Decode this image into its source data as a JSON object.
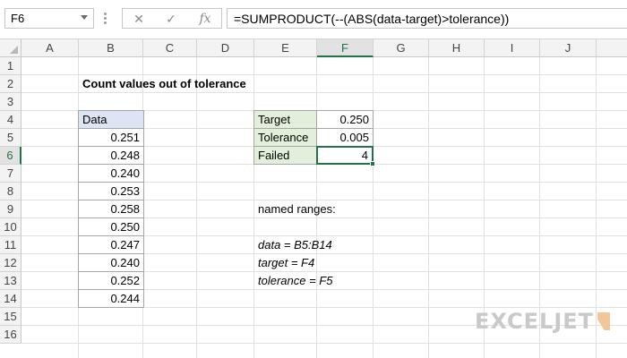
{
  "formula_bar": {
    "name_box": "F6",
    "cancel_symbol": "✕",
    "enter_symbol": "✓",
    "fx_symbol": "fx",
    "formula": "=SUMPRODUCT(--(ABS(data-target)>tolerance))"
  },
  "columns": [
    "A",
    "B",
    "C",
    "D",
    "E",
    "F",
    "G",
    "H",
    "I",
    "J"
  ],
  "active_column": "F",
  "rows": [
    "1",
    "2",
    "3",
    "4",
    "5",
    "6",
    "7",
    "8",
    "9",
    "10",
    "11",
    "12",
    "13",
    "14",
    "15",
    "16"
  ],
  "active_row": "6",
  "sheet": {
    "title": "Count values out of tolerance",
    "data_header": "Data",
    "data_values": [
      "0.251",
      "0.248",
      "0.240",
      "0.253",
      "0.258",
      "0.250",
      "0.247",
      "0.240",
      "0.252",
      "0.244"
    ],
    "inputs": [
      {
        "label": "Target",
        "value": "0.250"
      },
      {
        "label": "Tolerance",
        "value": "0.005"
      },
      {
        "label": "Failed",
        "value": "4"
      }
    ],
    "named_ranges_title": "named ranges:",
    "named_ranges": [
      "data = B5:B14",
      "target = F4",
      "tolerance = F5"
    ]
  },
  "logo": "EXCELJET",
  "colors": {
    "excel_green": "#217346",
    "label_fill": "#e2efda",
    "header_fill": "#dde5f4"
  }
}
